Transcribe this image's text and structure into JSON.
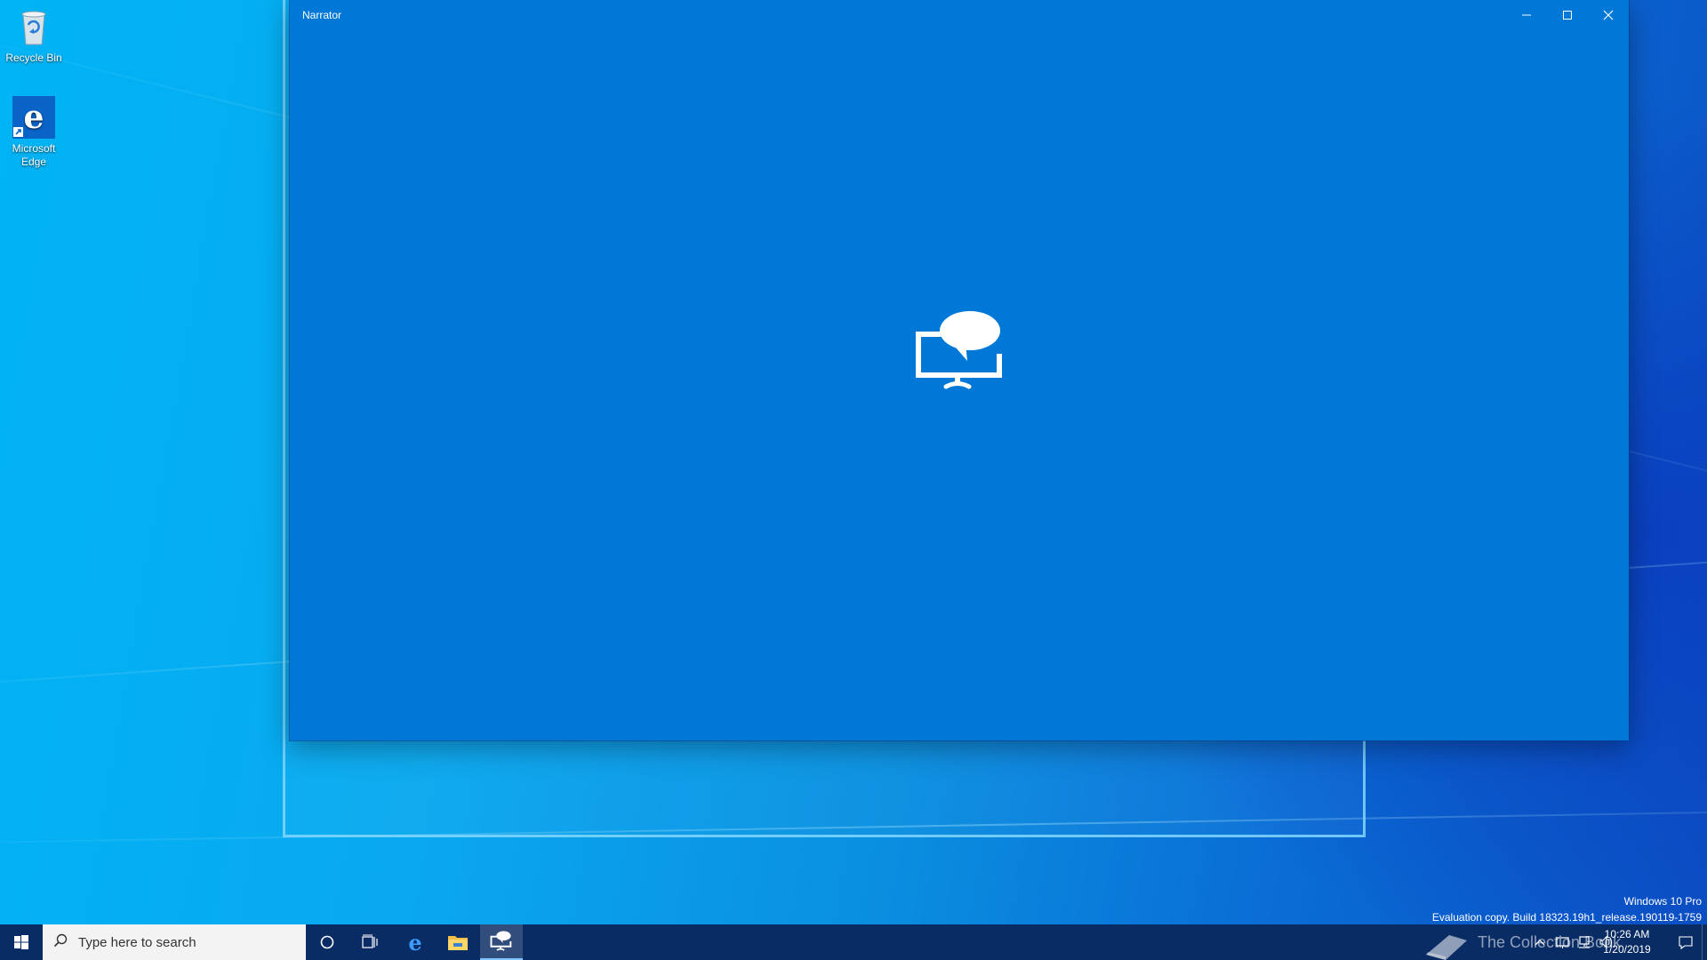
{
  "desktop": {
    "icons": [
      {
        "label": "Recycle Bin"
      },
      {
        "label": "Microsoft Edge"
      }
    ]
  },
  "window": {
    "title": "Narrator",
    "background_color": "#0078d7",
    "icons": {
      "minimize": "minimize-icon",
      "maximize": "maximize-icon",
      "close": "close-icon",
      "logo": "narrator-logo-icon"
    }
  },
  "watermark": {
    "line1": "Windows 10 Pro",
    "line2": "Evaluation copy. Build 18323.19h1_release.190119-1759"
  },
  "taskbar": {
    "search_placeholder": "Type here to search",
    "clock_time": "10:26 AM",
    "clock_date": "1/20/2019",
    "overlay_logo_text": "The Collection Book",
    "background_color": "#0a2c64"
  }
}
